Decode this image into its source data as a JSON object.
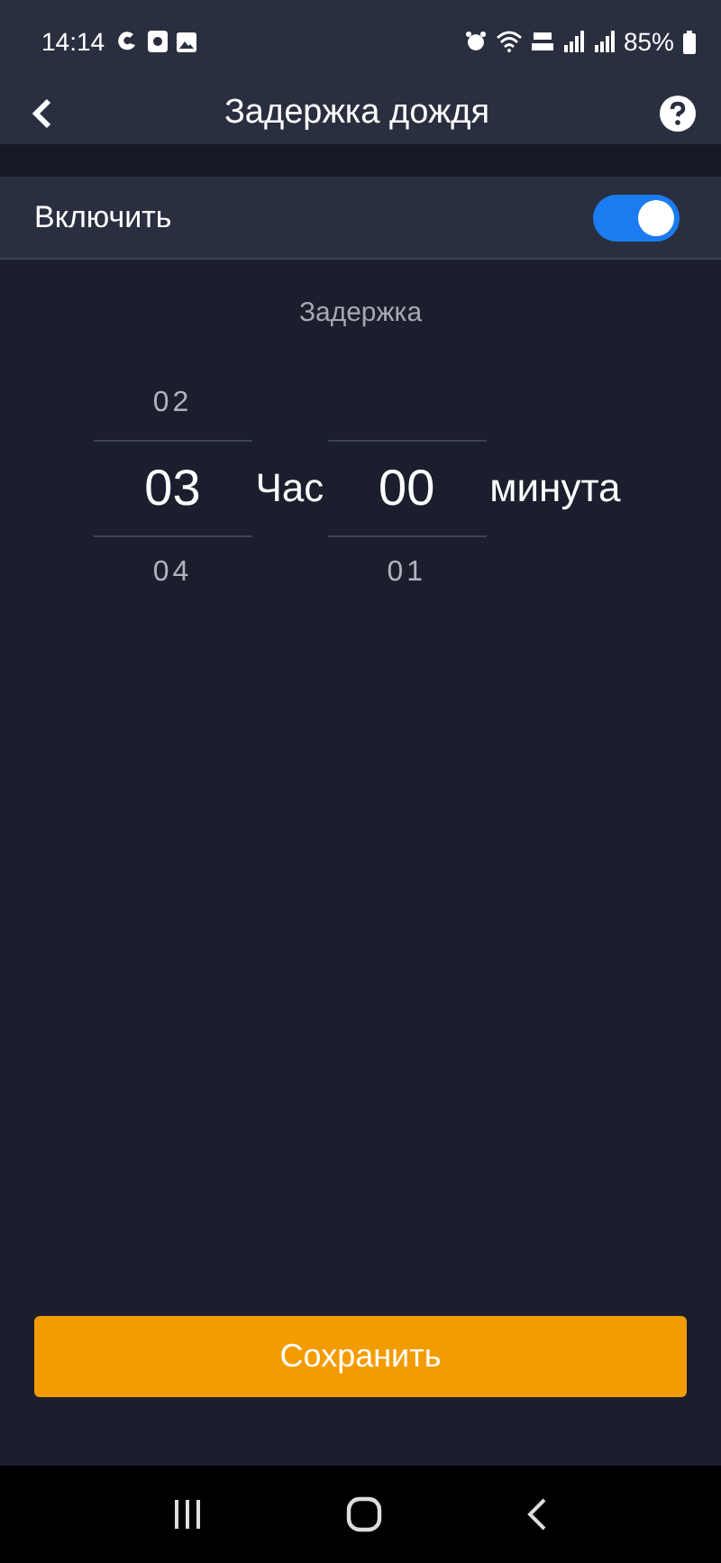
{
  "status_bar": {
    "time": "14:14",
    "battery": "85%"
  },
  "header": {
    "title": "Задержка дождя"
  },
  "toggle": {
    "label": "Включить",
    "on": true
  },
  "picker": {
    "label": "Задержка",
    "columns": [
      {
        "above": "02",
        "value": "03",
        "below": "04",
        "unit": "Час"
      },
      {
        "value": "00",
        "below": "01",
        "unit": "минута"
      }
    ]
  },
  "save_button": "Сохранить"
}
